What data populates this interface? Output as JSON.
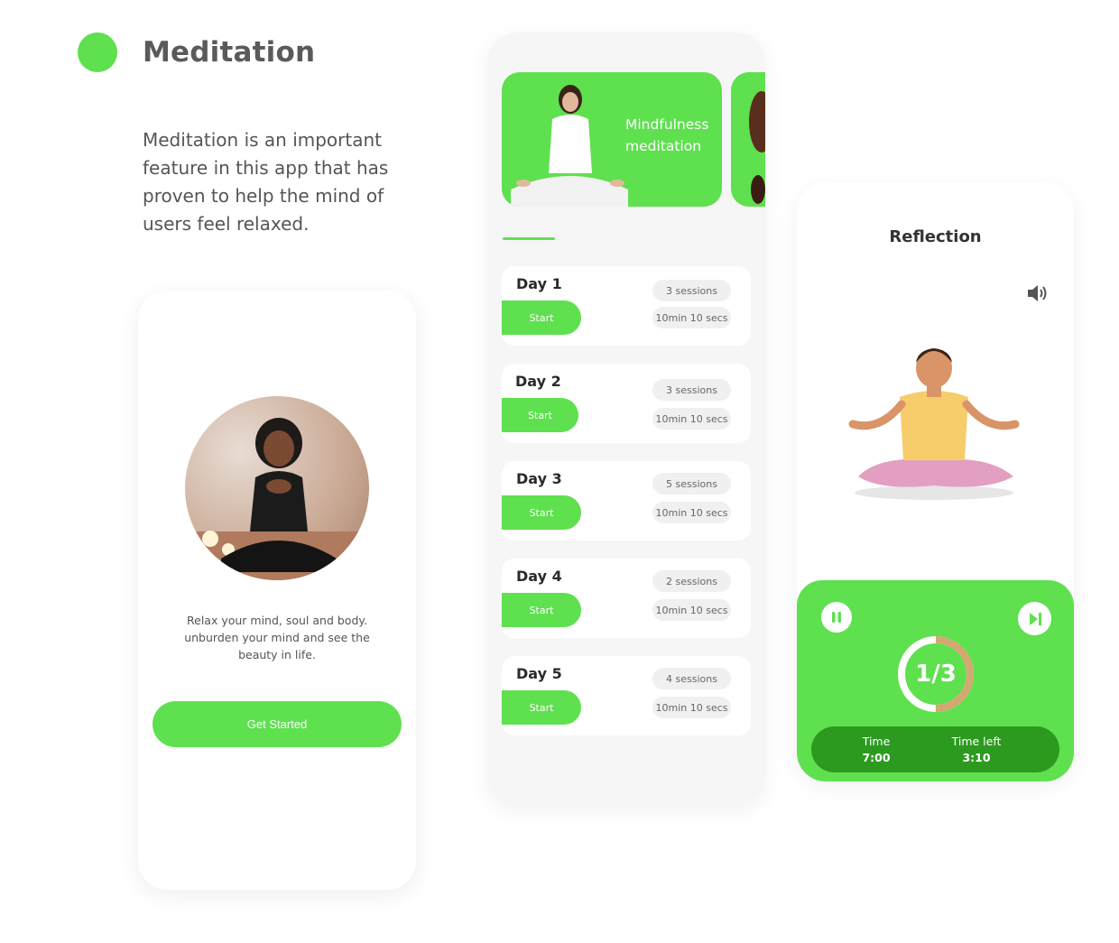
{
  "header": {
    "title": "Meditation",
    "description": "Meditation is an important feature in this app that has proven to help the mind of users feel relaxed."
  },
  "onboarding": {
    "text": "Relax your mind, soul and body. unburden your mind and see the beauty in life.",
    "button_label": "Get Started"
  },
  "program": {
    "banner_title": "Mindfulness meditation",
    "days": [
      {
        "title": "Day 1",
        "start_label": "Start",
        "sessions": "3 sessions",
        "duration": "10min 10 secs"
      },
      {
        "title": "Day 2",
        "start_label": "Start",
        "sessions": "3 sessions",
        "duration": "10min 10 secs"
      },
      {
        "title": "Day 3",
        "start_label": "Start",
        "sessions": "5 sessions",
        "duration": "10min 10 secs"
      },
      {
        "title": "Day 4",
        "start_label": "Start",
        "sessions": "2 sessions",
        "duration": "10min 10 secs"
      },
      {
        "title": "Day 5",
        "start_label": "Start",
        "sessions": "4 sessions",
        "duration": "10min 10 secs"
      }
    ]
  },
  "player": {
    "title": "Reflection",
    "progress_label": "1/3",
    "progress_fraction": 0.5,
    "time_label": "Time",
    "time_value": "7:00",
    "time_left_label": "Time left",
    "time_left_value": "3:10",
    "icons": [
      "speaker-icon",
      "pause-icon",
      "skip-next-icon"
    ]
  },
  "colors": {
    "accent": "#5fe04f",
    "accent_dark": "#2c9a1f",
    "ring_progress": "#d4a871"
  }
}
